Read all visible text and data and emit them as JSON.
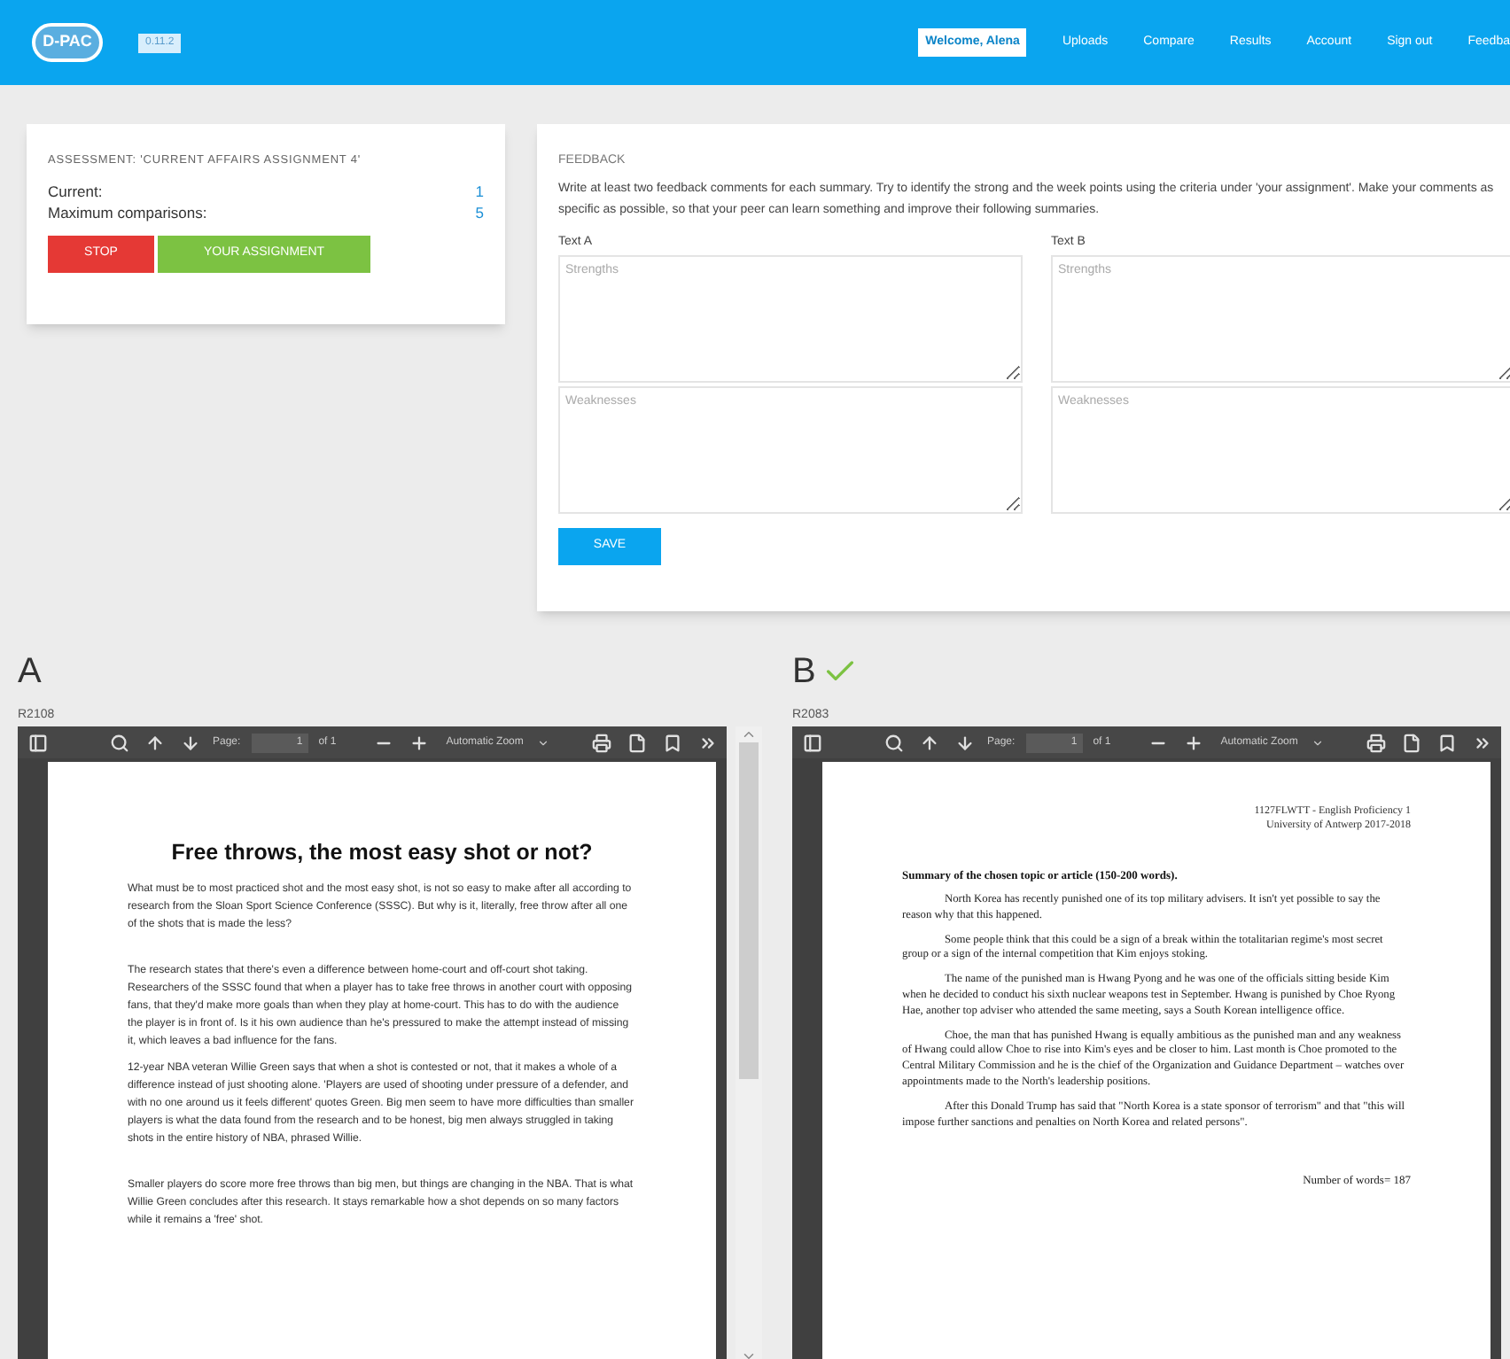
{
  "header": {
    "logo": "D-PAC",
    "version": "0.11.2",
    "welcome": "Welcome, Alena",
    "nav": [
      "Uploads",
      "Compare",
      "Results",
      "Account",
      "Sign out",
      "Feedba"
    ]
  },
  "assessment": {
    "title": "ASSESSMENT: 'CURRENT AFFAIRS ASSIGNMENT 4'",
    "stats": [
      {
        "label": "Current:",
        "value": "1"
      },
      {
        "label": "Maximum comparisons:",
        "value": "5"
      }
    ],
    "buttons": [
      {
        "label": "STOP",
        "kind": "stop"
      },
      {
        "label": "YOUR ASSIGNMENT",
        "kind": "assignment"
      }
    ]
  },
  "feedback": {
    "title": "FEEDBACK",
    "instructions": "Write at least two feedback comments for each summary. Try to identify the strong and the week points using the criteria under 'your assignment'. Make your comments as specific as possible, so that your peer can learn something and improve their following summaries.",
    "columns": [
      {
        "label": "Text A",
        "fields": [
          {
            "placeholder": "Strengths"
          },
          {
            "placeholder": "Weaknesses"
          }
        ]
      },
      {
        "label": "Text B",
        "fields": [
          {
            "placeholder": "Strengths"
          },
          {
            "placeholder": "Weaknesses"
          }
        ]
      }
    ],
    "save_button": "SAVE"
  },
  "documents": [
    {
      "label": "A",
      "checked": false,
      "code": "R2108",
      "toolbar": {
        "page_label": "Page:",
        "page_value": "1",
        "page_count": "of 1",
        "zoom": "Automatic Zoom"
      },
      "kind": "sans",
      "title": "Free throws, the most easy shot or not?",
      "paragraphs": [
        "What must be to most practiced shot and the most easy shot, is not so easy to make after all according to research from the Sloan Sport Science Conference (SSSC). But why is it, literally, free throw after all one of the shots that is made the less?",
        "The research states that there's even a difference between home-court and off-court shot taking. Researchers of the SSSC found that when a player has to take free throws in another court with opposing fans, that they'd make more goals than when they play at home-court. This has to do with the audience the player is in front of. Is it his own audience than he's pressured to make the attempt instead of missing it, which leaves a bad influence for the fans.",
        "12-year NBA veteran Willie Green says that when a shot is contested or not, that it makes a whole of a difference instead of just shooting alone. 'Players are used of shooting under pressure of a defender, and with no one around us it feels different' quotes Green. Big men seem to have more difficulties than smaller players is what the data found from the research and to be honest, big men always struggled in taking shots in the entire history of NBA, phrased Willie.",
        "Smaller players do score more free throws than big men, but things are changing in the NBA. That is what Willie Green concludes after this research. It stays remarkable how a shot depends on so many factors while it remains a 'free' shot."
      ]
    },
    {
      "label": "B",
      "checked": true,
      "code": "R2083",
      "toolbar": {
        "page_label": "Page:",
        "page_value": "1",
        "page_count": "of 1",
        "zoom": "Automatic Zoom"
      },
      "kind": "serif",
      "header_lines": [
        "1127FLWTT - English Proficiency 1",
        "University of Antwerp 2017-2018"
      ],
      "title": "Summary of the chosen topic or article (150-200 words).",
      "paragraphs": [
        "North Korea has recently punished one of its top military advisers. It isn't yet possible to say the reason why that this happened.",
        "Some people think that this could be a sign of a break within the totalitarian regime's most secret group or a sign of the internal competition that Kim enjoys stoking.",
        "The name of the punished man is Hwang Pyong and he was one of the officials sitting beside Kim when he decided to conduct his sixth nuclear weapons test in September. Hwang is punished by Choe Ryong Hae, another top adviser who attended the same meeting, says a South Korean intelligence office.",
        "Choe, the man that has punished Hwang is equally ambitious as the punished man and any weakness of Hwang could allow Choe to rise into Kim's eyes and be closer to him. Last month is Choe promoted to the Central Military Commission and he is the chief of the Organization and Guidance Department – watches over appointments made to the North's leadership positions.",
        "After this Donald Trump has said that \"North Korea is a state sponsor of terrorism\" and that \"this will impose further sanctions and penalties on North Korea and related persons\"."
      ],
      "footer": "Number of words= 187"
    }
  ]
}
